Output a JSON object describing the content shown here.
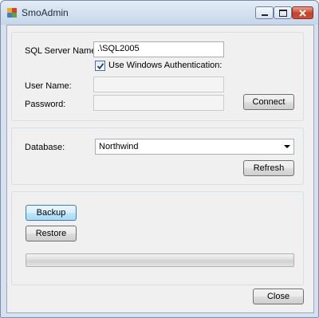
{
  "window": {
    "title": "SmoAdmin"
  },
  "connection": {
    "server_label": "SQL Server Name:",
    "server_value": ".\\SQL2005",
    "windows_auth_label": "Use Windows Authentication:",
    "windows_auth_checked": true,
    "username_label": "User Name:",
    "username_value": "",
    "password_label": "Password:",
    "password_value": "",
    "connect_label": "Connect"
  },
  "database": {
    "label": "Database:",
    "selected": "Northwind",
    "refresh_label": "Refresh"
  },
  "actions": {
    "backup_label": "Backup",
    "restore_label": "Restore",
    "progress": 0
  },
  "close_label": "Close",
  "icons": {
    "app": "app-window-icon",
    "minimize": "minimize-icon",
    "maximize": "maximize-icon",
    "close": "close-icon",
    "dropdown": "chevron-down-icon",
    "check": "checkmark-icon"
  },
  "colors": {
    "titlebar": "#d3e0ef",
    "close_button": "#c8412a",
    "focus_button": "#bee6fd",
    "dialog_bg": "#f0f0f0"
  }
}
